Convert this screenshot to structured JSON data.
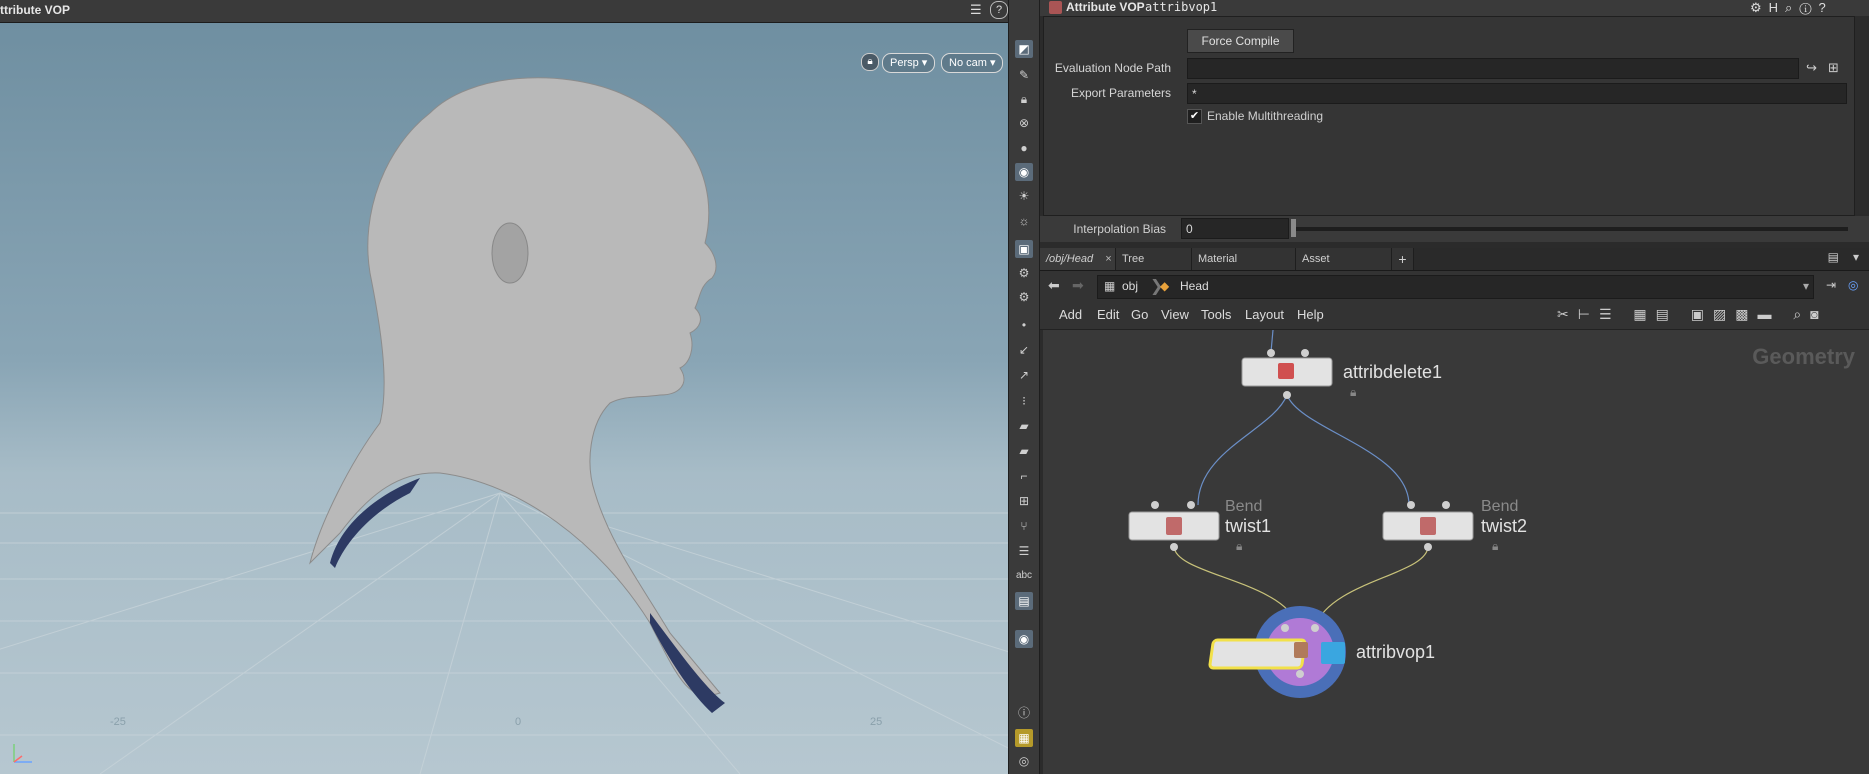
{
  "viewport": {
    "title": "ttribute VOP",
    "camera_view": "Persp",
    "camera_select": "No cam"
  },
  "params": {
    "node_type": "Attribute VOP",
    "node_name": "attribvop1",
    "force_compile": "Force Compile",
    "evaluation_node_path_label": "Evaluation Node Path",
    "evaluation_node_path_value": "",
    "export_parameters_label": "Export Parameters",
    "export_parameters_value": "*",
    "enable_multithreading_label": "Enable Multithreading",
    "enable_multithreading_checked": true,
    "interpolation_bias_label": "Interpolation Bias",
    "interpolation_bias_value": "0"
  },
  "network": {
    "tabs": [
      {
        "label": "/obj/Head"
      },
      {
        "label": "Tree View"
      },
      {
        "label": "Material Palette"
      },
      {
        "label": "Asset Browser"
      }
    ],
    "path": {
      "root": "obj",
      "current": "Head"
    },
    "menu": [
      "Add",
      "Edit",
      "Go",
      "View",
      "Tools",
      "Layout",
      "Help"
    ],
    "context_label": "Geometry",
    "nodes": {
      "attribdelete": {
        "name": "attribdelete1"
      },
      "twist1": {
        "name": "twist1",
        "type": "Bend"
      },
      "twist2": {
        "name": "twist2",
        "type": "Bend"
      },
      "attribvop": {
        "name": "attribvop1"
      }
    }
  },
  "colors": {
    "wire_blue": "#6b8fc7",
    "wire_yellow": "#c8c27a",
    "selected_outline": "#f2e14a",
    "display_flag": "#3aa6e0"
  }
}
